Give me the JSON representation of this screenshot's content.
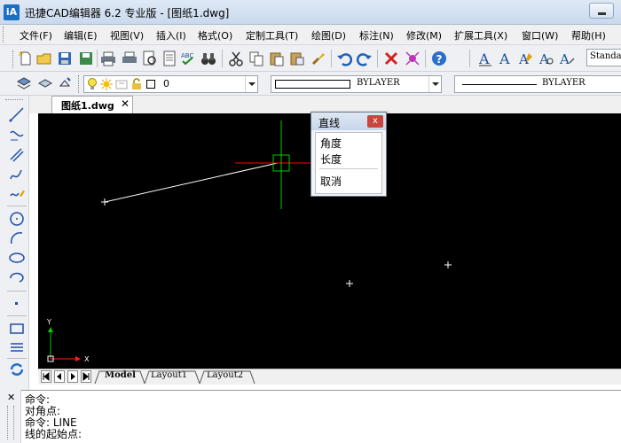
{
  "window": {
    "logo_text": "iA",
    "title": "迅捷CAD编辑器 6.2 专业版  - [图纸1.dwg]"
  },
  "menu": {
    "items": [
      "文件(F)",
      "编辑(E)",
      "视图(V)",
      "插入(I)",
      "格式(O)",
      "定制工具(T)",
      "绘图(D)",
      "标注(N)",
      "修改(M)",
      "扩展工具(X)",
      "窗口(W)",
      "帮助(H)"
    ]
  },
  "toolbar": {
    "text_style_value": "Standa",
    "layer_value": "0",
    "color_value": "BYLAYER",
    "linetype_value": "BYLAYER"
  },
  "document": {
    "tab_label": "图纸1.dwg",
    "tab_close": "✕"
  },
  "popup": {
    "title": "直线",
    "close": "x",
    "options": [
      "角度",
      "长度",
      "取消"
    ]
  },
  "canvas": {
    "ucs_x": "X",
    "ucs_y": "Y"
  },
  "layout_tabs": [
    "Model",
    "Layout1",
    "Layout2"
  ],
  "command": {
    "close": "✕",
    "lines": [
      "命令:",
      "对角点:",
      "命令:  LINE",
      "线的起始点:"
    ]
  },
  "colors": {
    "canvas_bg": "#000000",
    "crosshair_h": "#ff0000",
    "crosshair_v": "#00cc00",
    "line": "#ffffff"
  }
}
